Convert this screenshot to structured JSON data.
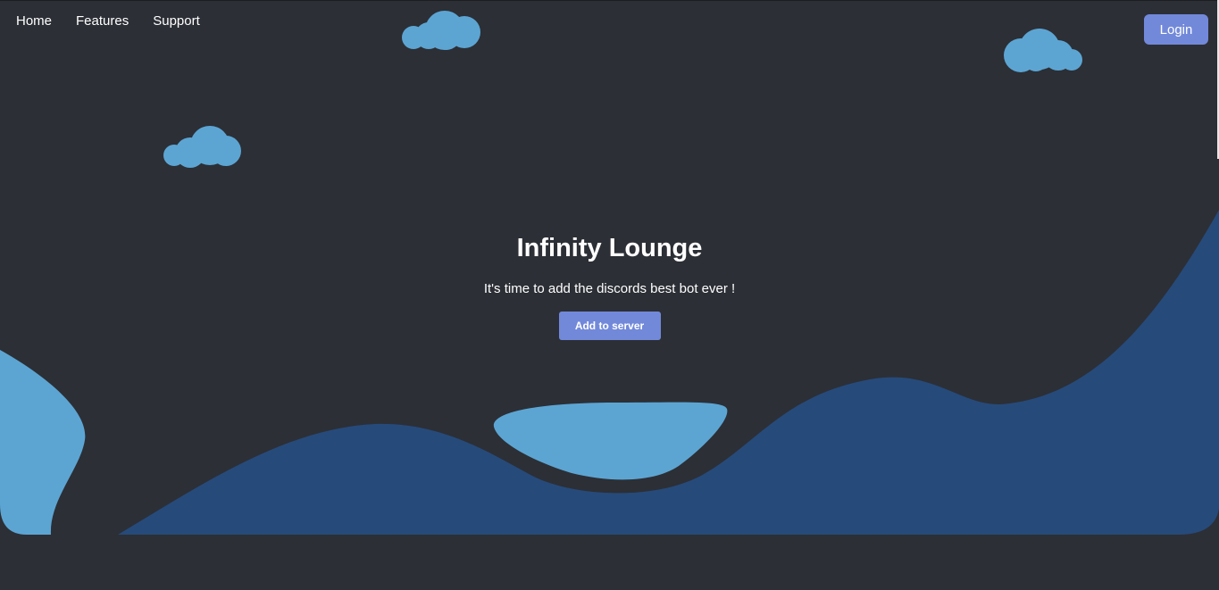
{
  "nav": {
    "items": [
      {
        "label": "Home"
      },
      {
        "label": "Features"
      },
      {
        "label": "Support"
      }
    ],
    "login_label": "Login"
  },
  "hero": {
    "title": "Infinity Lounge",
    "subtitle": "It's time to add the discords best bot ever !",
    "cta_label": "Add to server"
  },
  "colors": {
    "background": "#2c2f35",
    "accent_button": "#7289da",
    "wave_dark": "#264a7a",
    "wave_light": "#5ca5d3",
    "cloud": "#5ca5d3"
  }
}
